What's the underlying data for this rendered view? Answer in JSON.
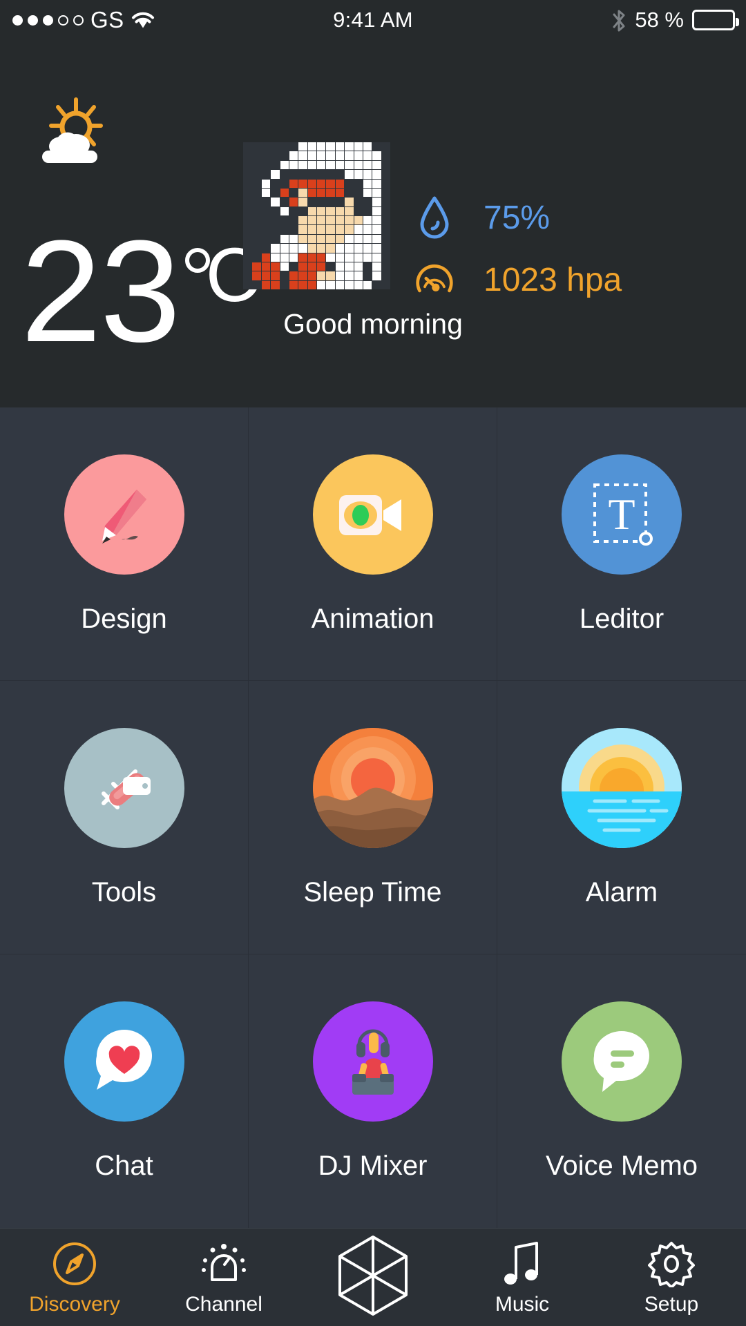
{
  "status_bar": {
    "signal_dots_filled": 3,
    "signal_dots_total": 5,
    "carrier": "GS",
    "wifi_icon": "wifi-icon",
    "time": "9:41 AM",
    "bluetooth_icon": "bluetooth-icon",
    "battery_percent": "58 %",
    "battery_level": 55
  },
  "weather": {
    "condition_icon": "sun-behind-cloud-icon",
    "temperature": "23",
    "unit": "C",
    "greeting": "Good morning",
    "avatar_icon": "pixel-art-avatar",
    "metrics": [
      {
        "icon": "water-drop-icon",
        "value": "75%",
        "color": "#5b9bea"
      },
      {
        "icon": "barometer-gauge-icon",
        "value": "1023 hpa",
        "color": "#f0a32c"
      }
    ]
  },
  "apps": [
    {
      "label": "Design",
      "icon": "pencil-icon",
      "bg": "#fb9a9c"
    },
    {
      "label": "Animation",
      "icon": "video-camera-icon",
      "bg": "#fbc65c"
    },
    {
      "label": "Leditor",
      "icon": "text-tool-icon",
      "bg": "#5293d6"
    },
    {
      "label": "Tools",
      "icon": "swiss-knife-icon",
      "bg": "#a7c0c6"
    },
    {
      "label": "Sleep Time",
      "icon": "sunset-dunes-icon",
      "bg": "#f4803c"
    },
    {
      "label": "Alarm",
      "icon": "sunrise-sea-icon",
      "bg": "#2ed0fb"
    },
    {
      "label": "Chat",
      "icon": "heart-bubble-icon",
      "bg": "#3fa2de"
    },
    {
      "label": "DJ Mixer",
      "icon": "dj-person-icon",
      "bg": "#a13cf5"
    },
    {
      "label": "Voice Memo",
      "icon": "speech-bubble-icon",
      "bg": "#9cca7c"
    }
  ],
  "nav": {
    "active_color": "#f0a32c",
    "items": [
      {
        "label": "Discovery",
        "icon": "compass-icon",
        "active": true
      },
      {
        "label": "Channel",
        "icon": "bell-dome-icon",
        "active": false
      },
      {
        "label": "",
        "icon": "cube-icon",
        "active": false
      },
      {
        "label": "Music",
        "icon": "music-note-icon",
        "active": false
      },
      {
        "label": "Setup",
        "icon": "gear-icon",
        "active": false
      }
    ]
  }
}
